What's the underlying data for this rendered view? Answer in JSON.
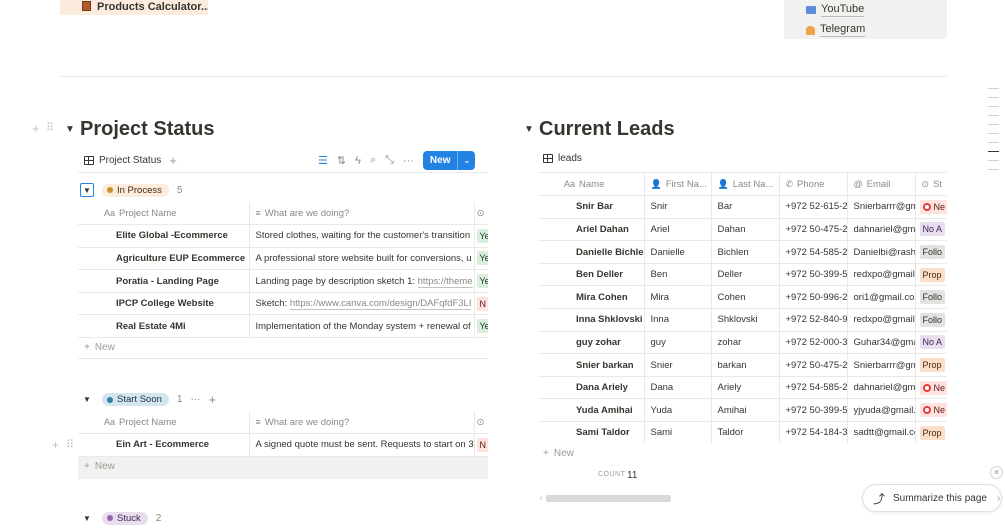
{
  "top": {
    "page_link": "Products Calculator...",
    "callout_links": [
      "YouTube",
      "Telegram"
    ]
  },
  "project_status": {
    "title": "Project Status",
    "view_name": "Project Status",
    "new_button": "New",
    "columns": [
      "Project Name",
      "What are we doing?"
    ],
    "groups": [
      {
        "label": "In Process",
        "count": "5",
        "color": "#cb912f",
        "bg": "#fbecdd",
        "rows": [
          {
            "name": "Elite Global -Ecommerce",
            "what": "Stored clothes, waiting for the customer's transition",
            "status": "Ye"
          },
          {
            "name": "Agriculture EUP Ecommerce",
            "what": "A professional store website built for conversions, u",
            "status": "Ye"
          },
          {
            "name": "Poratia - Landing Page",
            "what_prefix": "Landing page by description sketch 1: ",
            "what_link": "https://theme",
            "status": "Ye"
          },
          {
            "name": "IPCP College Website",
            "what_prefix": "Sketch: ",
            "what_link": "https://www.canva.com/design/DAFqfdF3LI",
            "status": "N"
          },
          {
            "name": "Real Estate 4Mi",
            "what": "Implementation of the Monday system + renewal of",
            "status": "Ye"
          }
        ]
      },
      {
        "label": "Start Soon",
        "count": "1",
        "color": "#337ea9",
        "bg": "#d3e5ef",
        "rows": [
          {
            "name": "Ein Art - Ecommerce",
            "what": "A signed quote must be sent. Requests to start on 3",
            "status": "N"
          }
        ]
      },
      {
        "label": "Stuck",
        "count": "2",
        "color": "#9065b0",
        "bg": "#e8deee"
      }
    ],
    "new_row_label": "New"
  },
  "current_leads": {
    "title": "Current Leads",
    "view_name": "leads",
    "columns": [
      "Name",
      "First Na...",
      "Last Na...",
      "Phone",
      "Email",
      "St"
    ],
    "rows": [
      {
        "name": "Snir Bar",
        "first": "Snir",
        "last": "Bar",
        "phone": "+972 52-615-2",
        "email": "Snierbarrr@gm",
        "status": "Ne",
        "kind": "new"
      },
      {
        "name": "Ariel Dahan",
        "first": "Ariel",
        "last": "Dahan",
        "phone": "+972 50-475-2",
        "email": "dahnariel@gma",
        "status": "No A",
        "kind": "noa"
      },
      {
        "name": "Danielle Bichlen",
        "first": "Danielle",
        "last": "Bichlen",
        "phone": "+972 54-585-2",
        "email": "Danielbi@rashi",
        "status": "Follo",
        "kind": "follow"
      },
      {
        "name": "Ben Deller",
        "first": "Ben",
        "last": "Deller",
        "phone": "+972 50-399-5",
        "email": "redxpo@gmail.",
        "status": "Prop",
        "kind": "prop"
      },
      {
        "name": "Mira Cohen",
        "first": "Mira",
        "last": "Cohen",
        "phone": "+972 50-996-2",
        "email": "ori1@gmail.cor",
        "status": "Follo",
        "kind": "follow"
      },
      {
        "name": "Inna Shklovski",
        "first": "Inna",
        "last": "Shklovski",
        "phone": "+972 52-840-9",
        "email": "redxpo@gmail.",
        "status": "Follo",
        "kind": "follow"
      },
      {
        "name": "guy zohar",
        "first": "guy",
        "last": "zohar",
        "phone": "+972 52-000-3",
        "email": "Guhar34@gma",
        "status": "No A",
        "kind": "noa"
      },
      {
        "name": "Snier barkan",
        "first": "Snier",
        "last": "barkan",
        "phone": "+972 50-475-2",
        "email": "Snierbarrr@gm",
        "status": "Prop",
        "kind": "prop"
      },
      {
        "name": "Dana Ariely",
        "first": "Dana",
        "last": "Ariely",
        "phone": "+972 54-585-2",
        "email": "dahnariel@gma",
        "status": "Ne",
        "kind": "new"
      },
      {
        "name": "Yuda Amihai",
        "first": "Yuda",
        "last": "Amihai",
        "phone": "+972 50-399-5",
        "email": "yjyuda@gmail.c",
        "status": "Ne",
        "kind": "new"
      },
      {
        "name": "Sami Taldor",
        "first": "Sami",
        "last": "Taldor",
        "phone": "+972 54-184-3",
        "email": "sadtt@gmail.cc",
        "status": "Prop",
        "kind": "prop"
      }
    ],
    "new_row_label": "New",
    "count_label": "COUNT",
    "count_value": "11"
  },
  "summarize_label": "Summarize this page"
}
